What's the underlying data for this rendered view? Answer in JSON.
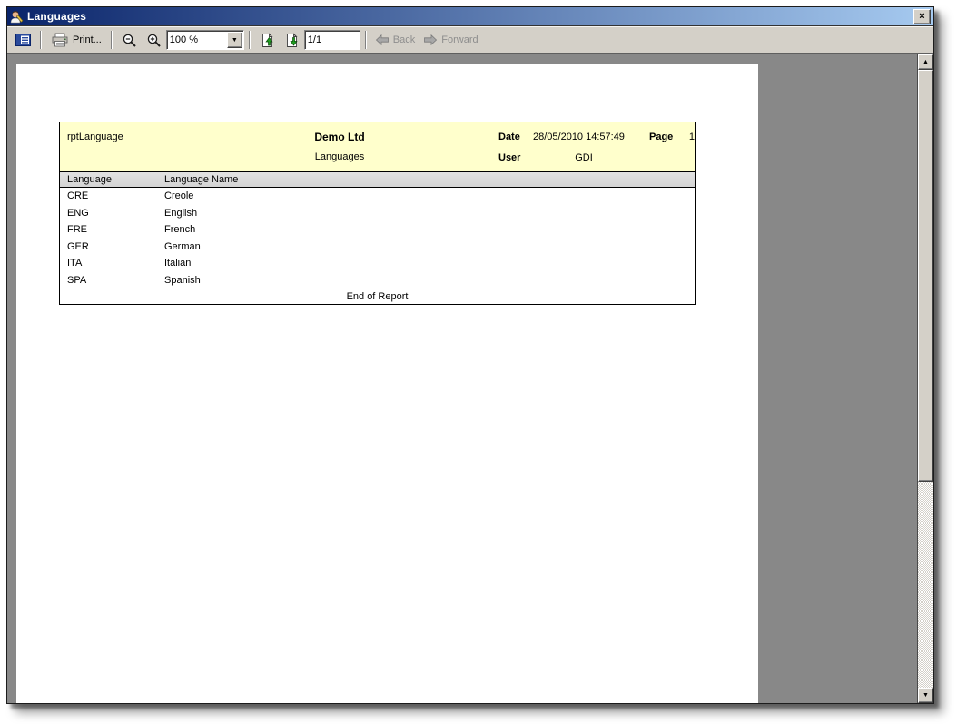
{
  "window": {
    "title": "Languages"
  },
  "icons": {
    "close_glyph": "×",
    "dropdown_glyph": "▼",
    "scroll_up_glyph": "▲",
    "scroll_down_glyph": "▼"
  },
  "toolbar": {
    "print_accel": "P",
    "print_rest": "rint...",
    "zoom_value": "100 %",
    "page_value": "1/1",
    "back_accel": "B",
    "back_rest": "ack",
    "forward_pre": "F",
    "forward_accel": "o",
    "forward_rest": "rward"
  },
  "report": {
    "name": "rptLanguage",
    "company": "Demo Ltd",
    "title": "Languages",
    "date_label": "Date",
    "date_value": "28/05/2010 14:57:49",
    "page_label": "Page",
    "page_number": "1",
    "user_label": "User",
    "user_value": "GDI",
    "columns": [
      "Language",
      "Language Name"
    ],
    "rows": [
      {
        "code": "CRE",
        "name": "Creole"
      },
      {
        "code": "ENG",
        "name": "English"
      },
      {
        "code": "FRE",
        "name": "French"
      },
      {
        "code": "GER",
        "name": "German"
      },
      {
        "code": "ITA",
        "name": "Italian"
      },
      {
        "code": "SPA",
        "name": "Spanish"
      }
    ],
    "footer": "End of Report"
  },
  "colors": {
    "titlebar_start": "#0a246a",
    "titlebar_end": "#a6caf0",
    "toolbar_bg": "#d4d0c8",
    "preview_bg": "#888888",
    "report_header_bg": "#ffffcc",
    "column_header_bg": "#d4d4d4",
    "arrow_green": "#1f9e1f",
    "disabled_text": "#8e8e8e"
  }
}
